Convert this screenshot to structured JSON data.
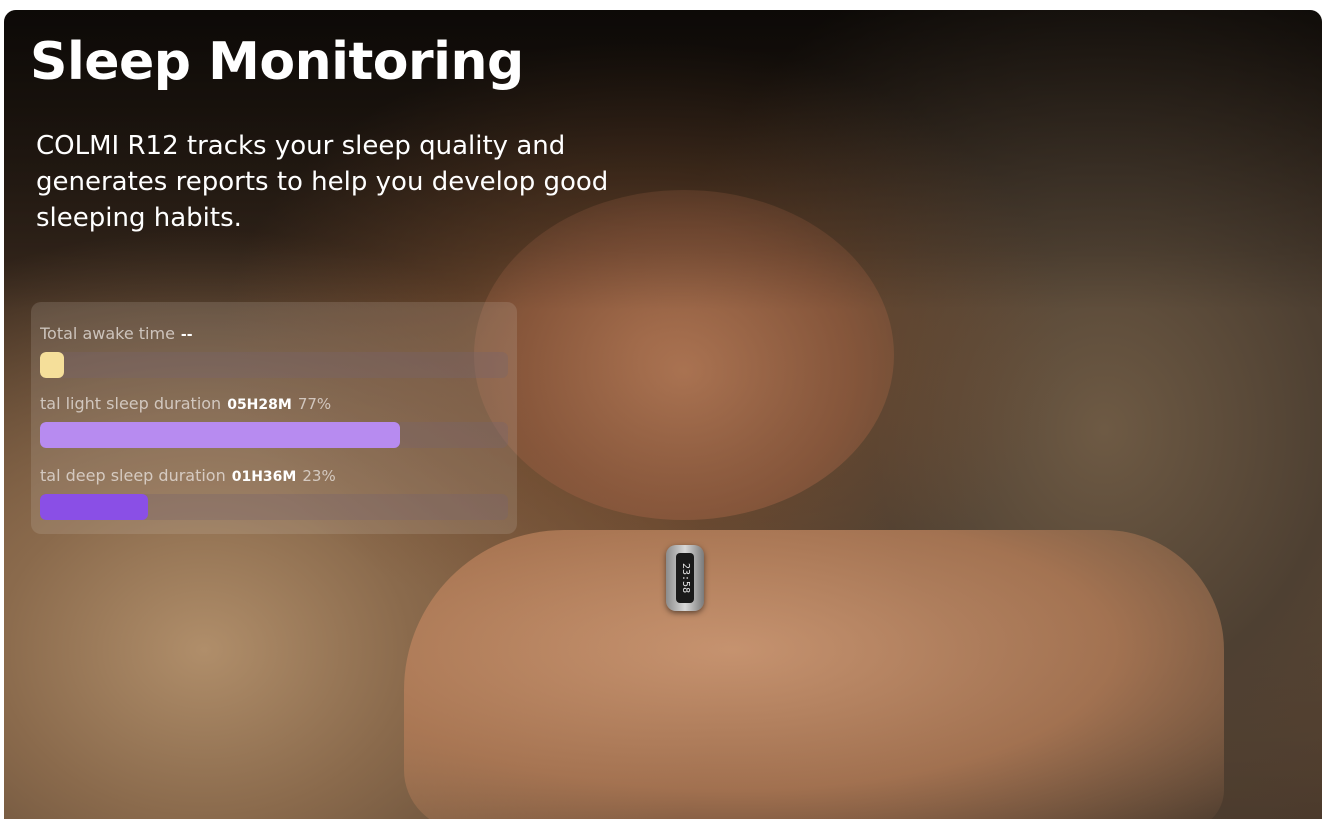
{
  "header": {
    "title": "Sleep Monitoring",
    "subtitle": "COLMI R12 tracks your sleep quality and generates reports to help you develop good sleeping habits."
  },
  "ring_display": {
    "time": "23:58"
  },
  "sleep_stats": [
    {
      "label": "Total awake time",
      "value": "--",
      "percent": "",
      "fraction": 0.05,
      "color": "#f5df9a"
    },
    {
      "label": "tal light sleep duration",
      "value": "05H28M",
      "percent": "77%",
      "fraction": 0.77,
      "color": "#b78bf0"
    },
    {
      "label": "tal deep sleep duration",
      "value": "01H36M",
      "percent": "23%",
      "fraction": 0.23,
      "color": "#8a4fe6"
    }
  ]
}
